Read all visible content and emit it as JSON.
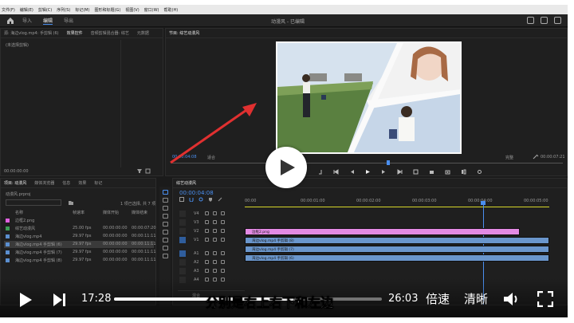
{
  "menu": [
    "文件(F)",
    "编辑(E)",
    "剪辑(C)",
    "序列(S)",
    "标记(M)",
    "图形和标题(G)",
    "视图(V)",
    "窗口(W)",
    "帮助(H)"
  ],
  "tabs": {
    "import": "导入",
    "edit": "编辑",
    "export": "导出"
  },
  "window_title": "动漫风 - 已编辑",
  "source_panel": {
    "tabs": [
      "源: 海边vlog.mp4: 手剪辑 (6)",
      "效果控件",
      "音频剪辑混合器: 综艺",
      "元数据"
    ],
    "no_clip": "(未选择剪辑)",
    "timecode": "00:00:00:00"
  },
  "program_panel": {
    "title": "节目: 综艺动漫风",
    "timecode": "00:00:04:08",
    "fit": "适合",
    "zoom": "完整",
    "duration": "00:00:07:21"
  },
  "project_panel": {
    "tabs": [
      "项目: 动漫风",
      "媒体浏览器",
      "信息",
      "效果",
      "标记"
    ],
    "project_file": "动漫风.prproj",
    "selection": "1 项已选择, 共 7 项",
    "columns": [
      "名称",
      "帧速率",
      "媒体开始",
      "媒体结束"
    ],
    "items": [
      {
        "name": "边框2.png",
        "fps": "",
        "start": "",
        "end": "",
        "color": "#e060e0"
      },
      {
        "name": "综艺动漫风",
        "fps": "25.00 fps",
        "start": "00:00:00:00",
        "end": "00:00:07:20",
        "color": "#3a9e55"
      },
      {
        "name": "海边vlog.mp4",
        "fps": "29.97 fps",
        "start": "00:00:00:00",
        "end": "00:00:11:11",
        "color": "#5b8fd0"
      },
      {
        "name": "海边vlog.mp4 手剪辑 (6)",
        "fps": "29.97 fps",
        "start": "00:00:00:00",
        "end": "00:00:11:11",
        "color": "#5b8fd0"
      },
      {
        "name": "海边vlog.mp4 手剪辑 (7)",
        "fps": "29.97 fps",
        "start": "00:00:00:00",
        "end": "00:00:11:11",
        "color": "#5b8fd0"
      },
      {
        "name": "海边vlog.mp4 手剪辑 (8)",
        "fps": "29.97 fps",
        "start": "00:00:00:00",
        "end": "00:00:11:11",
        "color": "#5b8fd0"
      }
    ]
  },
  "timeline": {
    "title": "综艺动漫风",
    "timecode": "00:00:04:08",
    "ruler": [
      "00:00",
      "00:00:01:00",
      "00:00:02:00",
      "00:00:03:00",
      "00:00:04:00",
      "00:00:05:00"
    ],
    "tracks": [
      "V4",
      "V3",
      "V2",
      "V1",
      "A1",
      "A2",
      "A3",
      "A4"
    ],
    "clips": [
      {
        "label": "边框2.png",
        "color": "#e38ae3"
      },
      {
        "label": "海边vlog.mp4 手剪辑 (8)",
        "color": "#6a96cc"
      },
      {
        "label": "海边vlog.mp4 手剪辑 (7)",
        "color": "#6a96cc"
      },
      {
        "label": "海边vlog.mp4 手剪辑 (6)",
        "color": "#6a96cc"
      }
    ],
    "mix": "混合"
  },
  "player": {
    "current_time": "17:28",
    "duration": "26:03",
    "progress": 0.67,
    "subtitle": "分别是右上右下和左边",
    "speed_label": "倍速",
    "quality_label": "清晰"
  },
  "colors": {
    "accent": "#4a8ff0",
    "arrow": "#e03030"
  }
}
